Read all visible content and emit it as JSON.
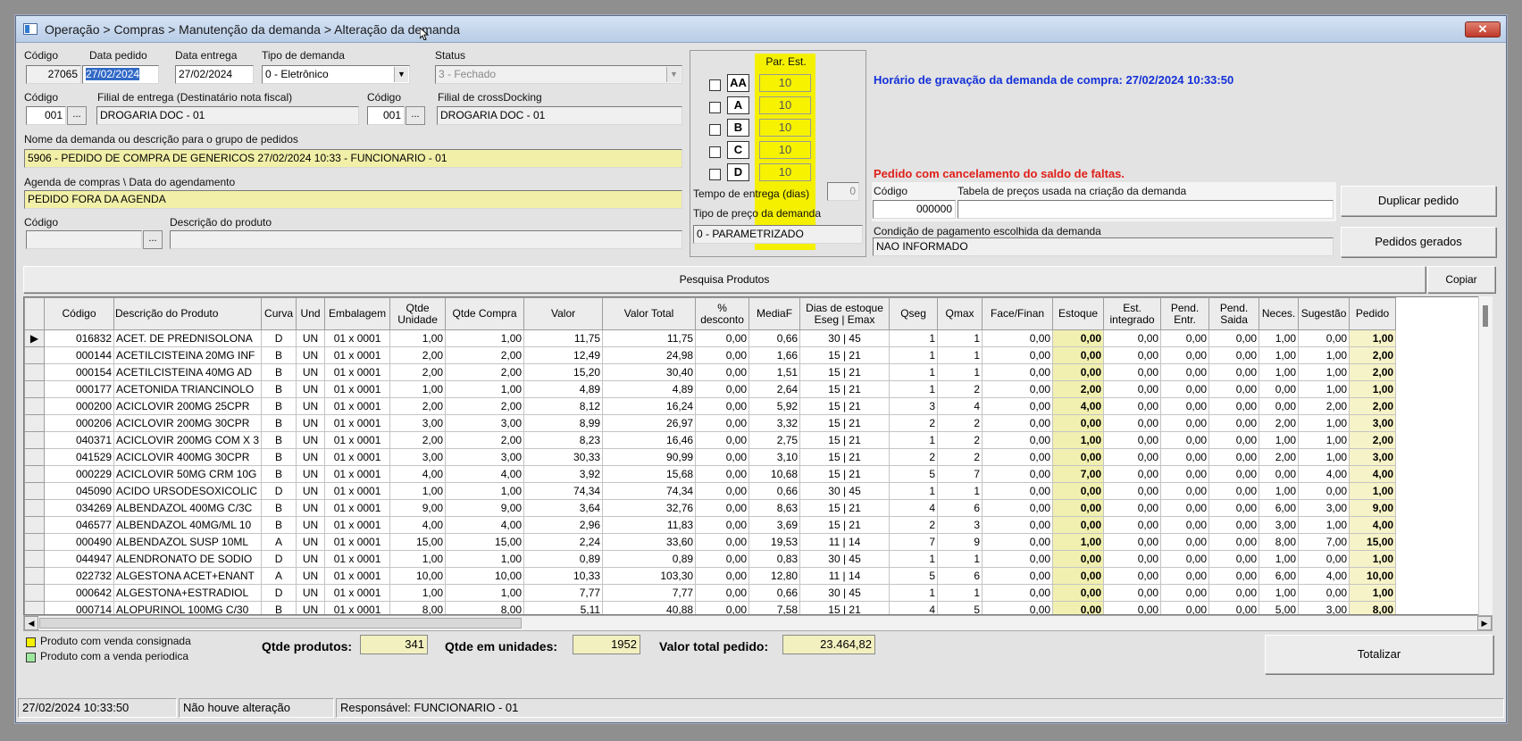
{
  "window": {
    "title": "Operação > Compras > Manutenção da demanda > Alteração da demanda",
    "close_label": "✕"
  },
  "header": {
    "codigo": {
      "label": "Código",
      "value": "27065"
    },
    "data_pedido": {
      "label": "Data pedido",
      "value": "27/02/2024"
    },
    "data_entrega": {
      "label": "Data entrega",
      "value": "27/02/2024"
    },
    "tipo_demanda": {
      "label": "Tipo de demanda",
      "value": "0 - Eletrônico"
    },
    "status": {
      "label": "Status",
      "value": "3 - Fechado"
    },
    "codigo_filial": {
      "label": "Código",
      "value": "001"
    },
    "filial_entrega": {
      "label": "Filial de entrega (Destinatário nota fiscal)",
      "value": "DROGARIA DOC - 01"
    },
    "codigo_crossdocking": {
      "label": "Código",
      "value": "001"
    },
    "filial_crossdocking": {
      "label": "Filial de crossDocking",
      "value": "DROGARIA DOC - 01"
    },
    "nome_demanda": {
      "label": "Nome da demanda ou descrição para o grupo de pedidos",
      "value": "5906 - PEDIDO DE COMPRA DE GENERICOS 27/02/2024 10:33 - FUNCIONARIO - 01"
    },
    "agenda": {
      "label": "Agenda de compras \\ Data do agendamento",
      "value": "PEDIDO FORA DA AGENDA"
    },
    "codigo_produto": {
      "label": "Código",
      "value": ""
    },
    "descricao_produto": {
      "label": "Descrição do produto",
      "value": ""
    },
    "ellipsis": "..."
  },
  "par_est": {
    "title": "Par. Est.",
    "rows": [
      {
        "letter": "AA",
        "value": "10"
      },
      {
        "letter": "A",
        "value": "10"
      },
      {
        "letter": "B",
        "value": "10"
      },
      {
        "letter": "C",
        "value": "10"
      },
      {
        "letter": "D",
        "value": "10"
      }
    ],
    "tempo_entrega_label": "Tempo de entrega (dias)",
    "tempo_entrega_value": "0",
    "tipo_preco_label": "Tipo de preço da demanda",
    "tipo_preco_value": "0 - PARAMETRIZADO"
  },
  "messages": {
    "horario": "Horário de gravação da demanda de compra: 27/02/2024 10:33:50",
    "cancelamento": "Pedido com cancelamento do saldo de faltas."
  },
  "tabela_precos": {
    "codigo_label": "Código",
    "codigo_value": "000000",
    "label": "Tabela de preços usada na criação da demanda",
    "value": ""
  },
  "condicao_pagamento": {
    "label": "Condição de pagamento escolhida da demanda",
    "value": "NAO INFORMADO"
  },
  "buttons": {
    "duplicar": "Duplicar pedido",
    "pedidos_gerados": "Pedidos gerados",
    "pesquisa": "Pesquisa Produtos",
    "copiar": "Copiar",
    "totalizar": "Totalizar"
  },
  "grid": {
    "columns": [
      "Código",
      "Descrição do Produto",
      "Curva",
      "Und",
      "Embalagem",
      "Qtde Unidade",
      "Qtde Compra",
      "Valor",
      "Valor Total",
      "% desconto",
      "MediaF",
      "Dias de estoque Eseg | Emax",
      "Qseg",
      "Qmax",
      "Face/Finan",
      "Estoque",
      "Est. integrado",
      "Pend. Entr.",
      "Pend. Saida",
      "Neces.",
      "Sugestão",
      "Pedido"
    ],
    "rows": [
      [
        "016832",
        "ACET. DE PREDNISOLONA",
        "D",
        "UN",
        "01 x 0001",
        "1,00",
        "1,00",
        "11,75",
        "11,75",
        "0,00",
        "0,66",
        "30  |  45",
        "1",
        "1",
        "0,00",
        "0,00",
        "0,00",
        "0,00",
        "0,00",
        "1,00",
        "0,00",
        "1,00"
      ],
      [
        "000144",
        "ACETILCISTEINA 20MG INF",
        "B",
        "UN",
        "01 x 0001",
        "2,00",
        "2,00",
        "12,49",
        "24,98",
        "0,00",
        "1,66",
        "15  |  21",
        "1",
        "1",
        "0,00",
        "0,00",
        "0,00",
        "0,00",
        "0,00",
        "1,00",
        "1,00",
        "2,00"
      ],
      [
        "000154",
        "ACETILCISTEINA 40MG AD",
        "B",
        "UN",
        "01 x 0001",
        "2,00",
        "2,00",
        "15,20",
        "30,40",
        "0,00",
        "1,51",
        "15  |  21",
        "1",
        "1",
        "0,00",
        "0,00",
        "0,00",
        "0,00",
        "0,00",
        "1,00",
        "1,00",
        "2,00"
      ],
      [
        "000177",
        "ACETONIDA TRIANCINOLO",
        "B",
        "UN",
        "01 x 0001",
        "1,00",
        "1,00",
        "4,89",
        "4,89",
        "0,00",
        "2,64",
        "15  |  21",
        "1",
        "2",
        "0,00",
        "2,00",
        "0,00",
        "0,00",
        "0,00",
        "0,00",
        "1,00",
        "1,00"
      ],
      [
        "000200",
        "ACICLOVIR 200MG 25CPR",
        "B",
        "UN",
        "01 x 0001",
        "2,00",
        "2,00",
        "8,12",
        "16,24",
        "0,00",
        "5,92",
        "15  |  21",
        "3",
        "4",
        "0,00",
        "4,00",
        "0,00",
        "0,00",
        "0,00",
        "0,00",
        "2,00",
        "2,00"
      ],
      [
        "000206",
        "ACICLOVIR 200MG 30CPR",
        "B",
        "UN",
        "01 x 0001",
        "3,00",
        "3,00",
        "8,99",
        "26,97",
        "0,00",
        "3,32",
        "15  |  21",
        "2",
        "2",
        "0,00",
        "0,00",
        "0,00",
        "0,00",
        "0,00",
        "2,00",
        "1,00",
        "3,00"
      ],
      [
        "040371",
        "ACICLOVIR 200MG COM X 3",
        "B",
        "UN",
        "01 x 0001",
        "2,00",
        "2,00",
        "8,23",
        "16,46",
        "0,00",
        "2,75",
        "15  |  21",
        "1",
        "2",
        "0,00",
        "1,00",
        "0,00",
        "0,00",
        "0,00",
        "1,00",
        "1,00",
        "2,00"
      ],
      [
        "041529",
        "ACICLOVIR 400MG 30CPR",
        "B",
        "UN",
        "01 x 0001",
        "3,00",
        "3,00",
        "30,33",
        "90,99",
        "0,00",
        "3,10",
        "15  |  21",
        "2",
        "2",
        "0,00",
        "0,00",
        "0,00",
        "0,00",
        "0,00",
        "2,00",
        "1,00",
        "3,00"
      ],
      [
        "000229",
        "ACICLOVIR 50MG CRM 10G",
        "B",
        "UN",
        "01 x 0001",
        "4,00",
        "4,00",
        "3,92",
        "15,68",
        "0,00",
        "10,68",
        "15  |  21",
        "5",
        "7",
        "0,00",
        "7,00",
        "0,00",
        "0,00",
        "0,00",
        "0,00",
        "4,00",
        "4,00"
      ],
      [
        "045090",
        "ACIDO URSODESOXICOLIC",
        "D",
        "UN",
        "01 x 0001",
        "1,00",
        "1,00",
        "74,34",
        "74,34",
        "0,00",
        "0,66",
        "30  |  45",
        "1",
        "1",
        "0,00",
        "0,00",
        "0,00",
        "0,00",
        "0,00",
        "1,00",
        "0,00",
        "1,00"
      ],
      [
        "034269",
        "ALBENDAZOL 400MG C/3C",
        "B",
        "UN",
        "01 x 0001",
        "9,00",
        "9,00",
        "3,64",
        "32,76",
        "0,00",
        "8,63",
        "15  |  21",
        "4",
        "6",
        "0,00",
        "0,00",
        "0,00",
        "0,00",
        "0,00",
        "6,00",
        "3,00",
        "9,00"
      ],
      [
        "046577",
        "ALBENDAZOL 40MG/ML 10",
        "B",
        "UN",
        "01 x 0001",
        "4,00",
        "4,00",
        "2,96",
        "11,83",
        "0,00",
        "3,69",
        "15  |  21",
        "2",
        "3",
        "0,00",
        "0,00",
        "0,00",
        "0,00",
        "0,00",
        "3,00",
        "1,00",
        "4,00"
      ],
      [
        "000490",
        "ALBENDAZOL SUSP 10ML",
        "A",
        "UN",
        "01 x 0001",
        "15,00",
        "15,00",
        "2,24",
        "33,60",
        "0,00",
        "19,53",
        "11  |  14",
        "7",
        "9",
        "0,00",
        "1,00",
        "0,00",
        "0,00",
        "0,00",
        "8,00",
        "7,00",
        "15,00"
      ],
      [
        "044947",
        "ALENDRONATO DE SODIO",
        "D",
        "UN",
        "01 x 0001",
        "1,00",
        "1,00",
        "0,89",
        "0,89",
        "0,00",
        "0,83",
        "30  |  45",
        "1",
        "1",
        "0,00",
        "0,00",
        "0,00",
        "0,00",
        "0,00",
        "1,00",
        "0,00",
        "1,00"
      ],
      [
        "022732",
        "ALGESTONA ACET+ENANT",
        "A",
        "UN",
        "01 x 0001",
        "10,00",
        "10,00",
        "10,33",
        "103,30",
        "0,00",
        "12,80",
        "11  |  14",
        "5",
        "6",
        "0,00",
        "0,00",
        "0,00",
        "0,00",
        "0,00",
        "6,00",
        "4,00",
        "10,00"
      ],
      [
        "000642",
        "ALGESTONA+ESTRADIOL",
        "D",
        "UN",
        "01 x 0001",
        "1,00",
        "1,00",
        "7,77",
        "7,77",
        "0,00",
        "0,66",
        "30  |  45",
        "1",
        "1",
        "0,00",
        "0,00",
        "0,00",
        "0,00",
        "0,00",
        "1,00",
        "0,00",
        "1,00"
      ],
      [
        "000714",
        "ALOPURINOL 100MG C/30",
        "B",
        "UN",
        "01 x 0001",
        "8,00",
        "8,00",
        "5,11",
        "40,88",
        "0,00",
        "7,58",
        "15  |  21",
        "4",
        "5",
        "0,00",
        "0,00",
        "0,00",
        "0,00",
        "0,00",
        "5,00",
        "3,00",
        "8,00"
      ]
    ]
  },
  "legend": {
    "consignada": "Produto com venda consignada",
    "periodica": "Produto com a venda periodica",
    "consignada_color": "#f4f000",
    "periodica_color": "#9ee89e"
  },
  "totals": {
    "qtde_produtos_label": "Qtde produtos:",
    "qtde_produtos_value": "341",
    "qtde_unidades_label": "Qtde em unidades:",
    "qtde_unidades_value": "1952",
    "valor_total_label": "Valor total pedido:",
    "valor_total_value": "23.464,82"
  },
  "statusbar": {
    "datetime": "27/02/2024 10:33:50",
    "alteracao": "Não houve alteração",
    "responsavel": "Responsável: FUNCIONARIO - 01"
  }
}
